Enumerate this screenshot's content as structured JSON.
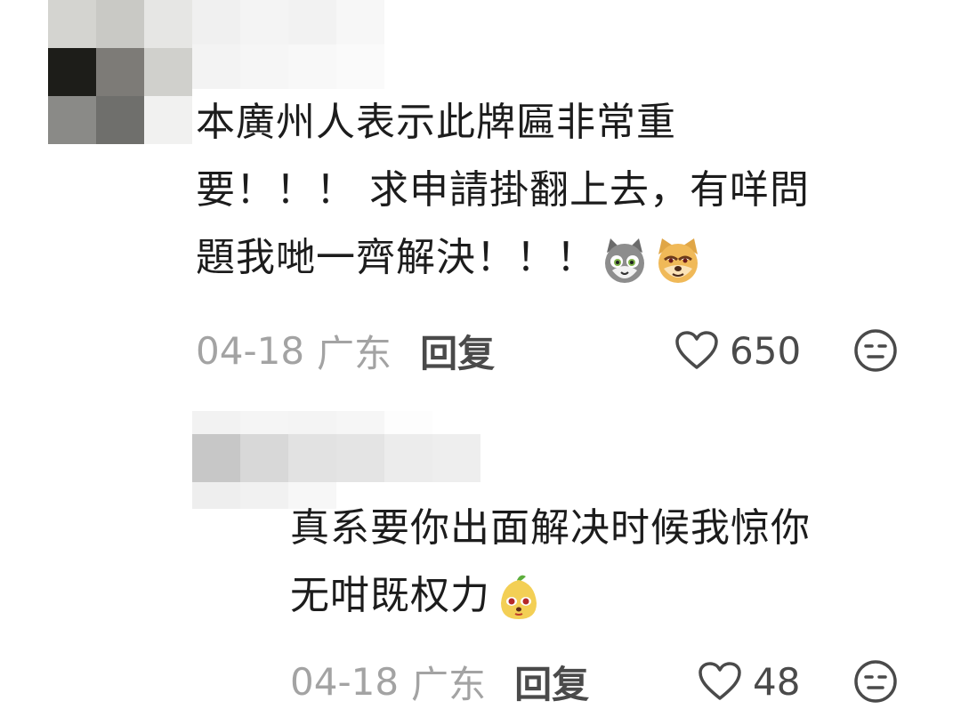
{
  "comments": [
    {
      "lines": [
        "本廣州人表示此牌匾非常重",
        "要！！！ 求申請掛翻上去，有咩問",
        "題我哋一齊解決！！！"
      ],
      "emojis": [
        "cat-face-emoji",
        "dog-face-emoji"
      ],
      "date": "04-18",
      "location": "广东",
      "reply_label": "回复",
      "likes": "650"
    },
    {
      "lines": [
        "真系要你出面解决时候我惊你",
        "无咁既权力"
      ],
      "emojis": [
        "pear-face-emoji"
      ],
      "date": "04-18",
      "location": "广东",
      "reply_label": "回复",
      "likes": "48"
    }
  ],
  "icons": {
    "like": "heart-outline-icon",
    "reaction": "neutral-face-icon"
  },
  "colors": {
    "meta_gray": "#a3a3a3",
    "text": "#1c1c1c",
    "action": "#4a4a4a"
  }
}
